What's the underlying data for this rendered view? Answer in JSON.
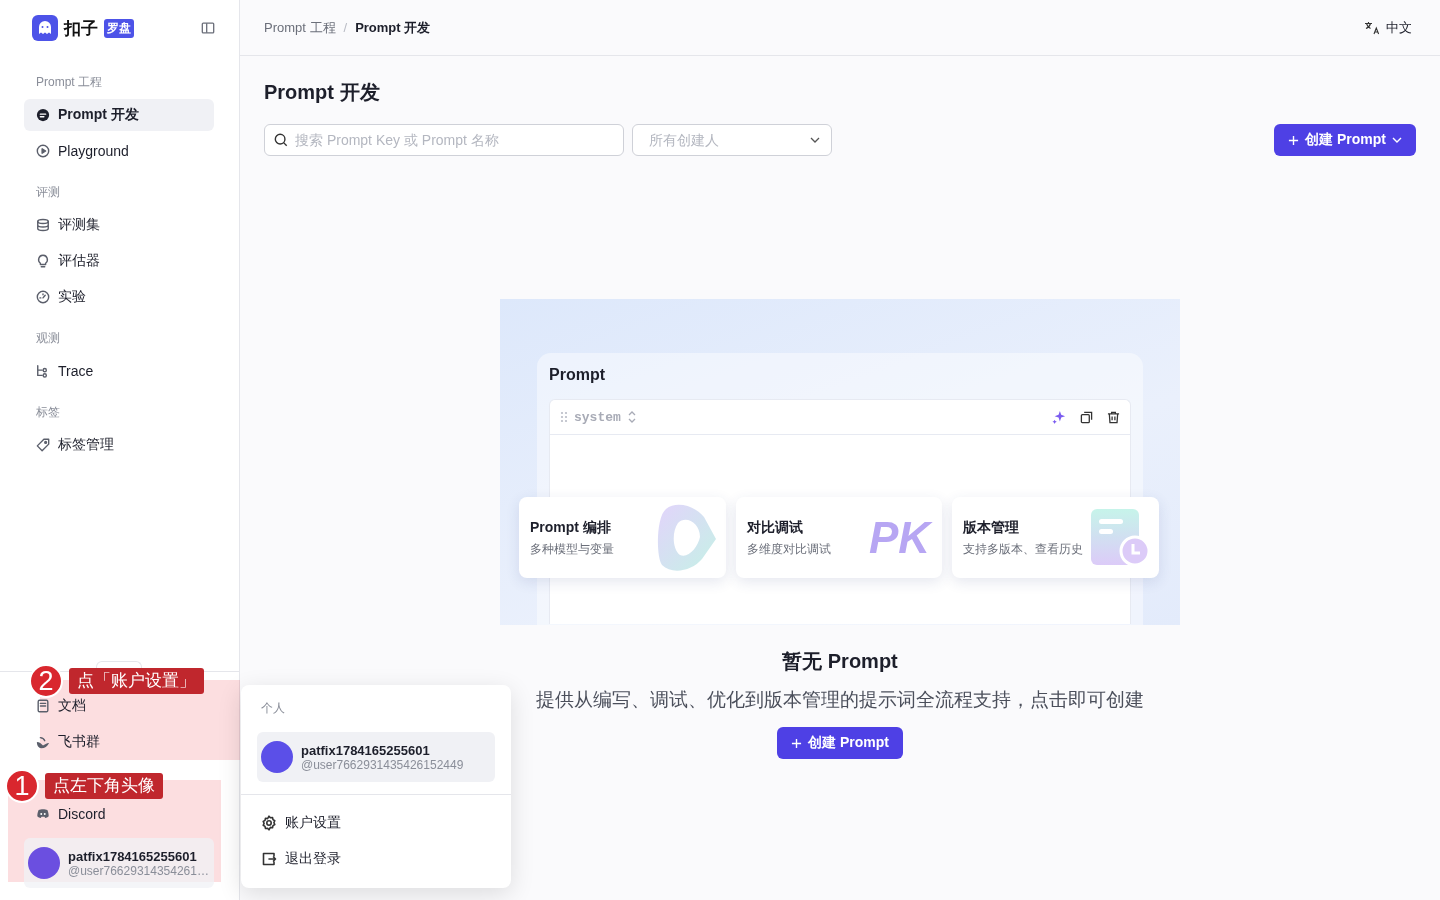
{
  "sidebar": {
    "logo_text": "扣子",
    "logo_badge": "罗盘",
    "groups": [
      {
        "title": "Prompt 工程",
        "items": [
          {
            "label": "Prompt 开发",
            "selected": true
          },
          {
            "label": "Playground",
            "selected": false
          }
        ]
      },
      {
        "title": "评测",
        "items": [
          {
            "label": "评测集",
            "selected": false
          },
          {
            "label": "评估器",
            "selected": false
          },
          {
            "label": "实验",
            "selected": false
          }
        ]
      },
      {
        "title": "观测",
        "items": [
          {
            "label": "Trace",
            "selected": false
          }
        ]
      },
      {
        "title": "标签",
        "items": [
          {
            "label": "标签管理",
            "selected": false
          }
        ]
      }
    ],
    "footer_links": [
      {
        "label": "文档"
      },
      {
        "label": "飞书群"
      },
      {
        "label": "Discord"
      }
    ],
    "user": {
      "name": "patfix1784165255601",
      "handle": "@user76629314354261…"
    }
  },
  "header": {
    "breadcrumb": [
      "Prompt 工程",
      "Prompt 开发"
    ],
    "breadcrumb_separator": "/",
    "language": "中文"
  },
  "page": {
    "title": "Prompt 开发",
    "search": {
      "placeholder": "搜索 Prompt Key 或 Prompt 名称"
    },
    "creator_filter": {
      "placeholder": "所有创建人"
    },
    "create_button": "创建 Prompt"
  },
  "empty_state": {
    "illustration": {
      "card_title": "Prompt",
      "role": "system",
      "features": [
        {
          "title": "Prompt 编排",
          "subtitle": "多种模型与变量"
        },
        {
          "title": "对比调试",
          "subtitle": "多维度对比调试",
          "art_text": "PK"
        },
        {
          "title": "版本管理",
          "subtitle": "支持多版本、查看历史"
        }
      ]
    },
    "title": "暂无 Prompt",
    "description": "提供从编写、调试、优化到版本管理的提示词全流程支持，点击即可创建",
    "button": "创建 Prompt"
  },
  "user_menu": {
    "section": "个人",
    "name": "patfix1784165255601",
    "handle": "@user7662931435426152449",
    "items": [
      {
        "label": "账户设置"
      },
      {
        "label": "退出登录"
      }
    ]
  },
  "annotations": [
    {
      "number": "2",
      "text": "点「账户设置」"
    },
    {
      "number": "1",
      "text": "点左下角头像"
    }
  ]
}
